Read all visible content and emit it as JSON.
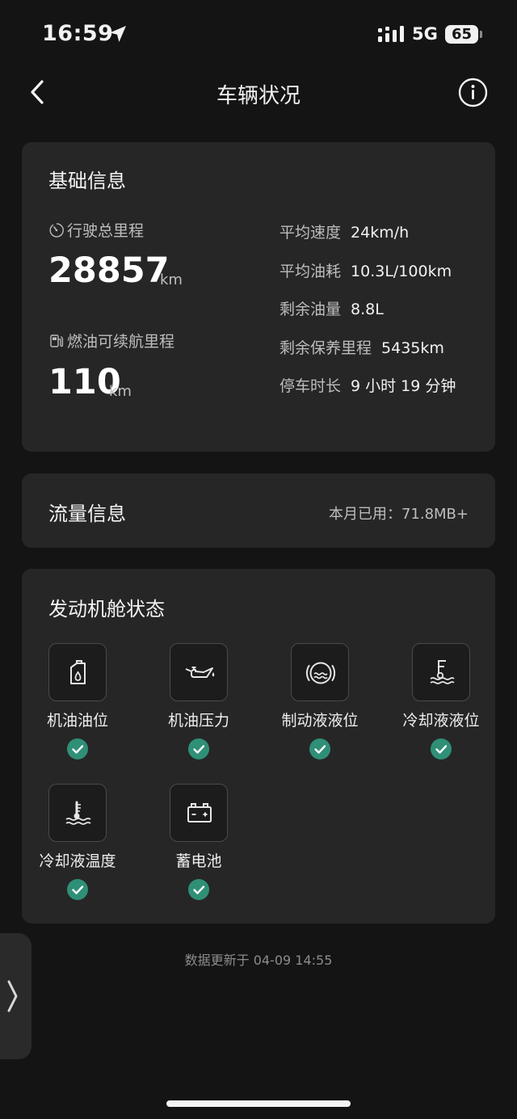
{
  "status_bar": {
    "time": "16:59",
    "network": "5G",
    "battery": "65",
    "location_icon": "location-arrow-icon",
    "signal_icon": "signal-icon"
  },
  "nav": {
    "title": "车辆状况",
    "back_icon": "chevron-left-icon",
    "info_icon": "info-icon"
  },
  "basic_info": {
    "title": "基础信息",
    "odometer": {
      "label": "行驶总里程",
      "value": "28857",
      "unit": "km",
      "icon": "gauge-icon"
    },
    "fuel_range": {
      "label": "燃油可续航里程",
      "value": "110",
      "unit": "km",
      "icon": "fuel-pump-icon"
    },
    "stats": [
      {
        "label": "平均速度",
        "value": "24km/h"
      },
      {
        "label": "平均油耗",
        "value": "10.3L/100km"
      },
      {
        "label": "剩余油量",
        "value": "8.8L"
      },
      {
        "label": "剩余保养里程",
        "value": "5435km"
      },
      {
        "label": "停车时长",
        "value": "9 小时 19 分钟"
      }
    ]
  },
  "traffic_info": {
    "title": "流量信息",
    "usage": "本月已用：71.8MB+"
  },
  "engine_status": {
    "title": "发动机舱状态",
    "items": [
      {
        "label": "机油油位",
        "icon": "oil-can-icon",
        "status": "ok"
      },
      {
        "label": "机油压力",
        "icon": "oil-pressure-icon",
        "status": "ok"
      },
      {
        "label": "制动液液位",
        "icon": "brake-fluid-icon",
        "status": "ok"
      },
      {
        "label": "冷却液液位",
        "icon": "coolant-level-icon",
        "status": "ok"
      },
      {
        "label": "冷却液温度",
        "icon": "coolant-temperature-icon",
        "status": "ok"
      },
      {
        "label": "蓄电池",
        "icon": "battery-icon",
        "status": "ok"
      }
    ]
  },
  "footer": {
    "update_time": "数据更新于 04-09 14:55"
  },
  "colors": {
    "background": "#141414",
    "card": "#262626",
    "check_ok": "#2f8f77"
  }
}
